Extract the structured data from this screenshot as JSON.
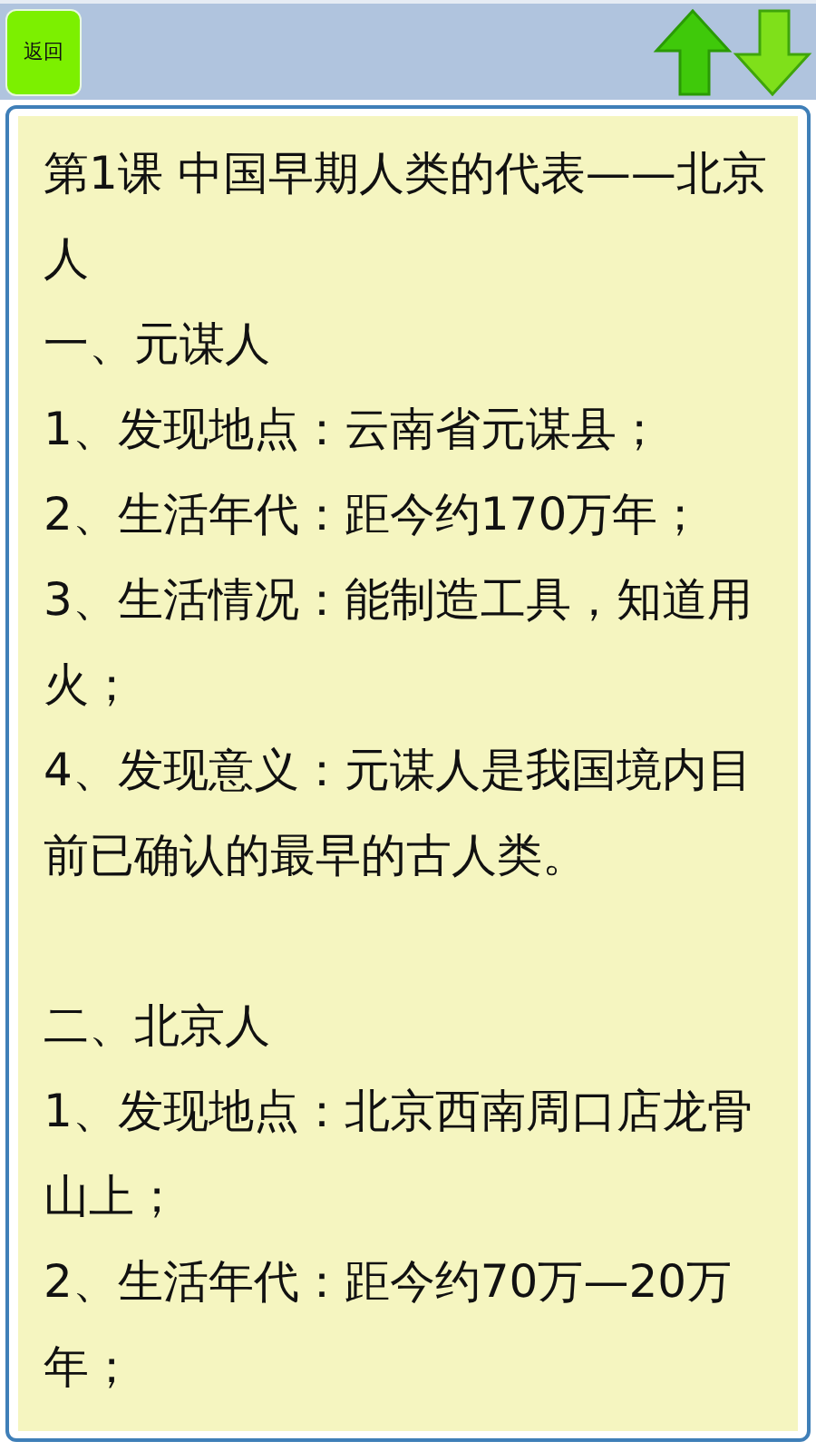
{
  "back_button": {
    "label": "返回"
  },
  "title": "第1课  中国早期人类的代表——北京人",
  "sections": [
    {
      "heading": "一、元谋人",
      "items": [
        "1、发现地点：云南省元谋县；",
        "2、生活年代：距今约170万年；",
        "3、生活情况：能制造工具，知道用火；",
        "4、发现意义：元谋人是我国境内目前已确认的最早的古人类。"
      ]
    },
    {
      "heading": "二、北京人",
      "items": [
        "1、发现地点：北京西南周口店龙骨山上；",
        "2、生活年代：距今约70万—20万年；"
      ]
    }
  ]
}
